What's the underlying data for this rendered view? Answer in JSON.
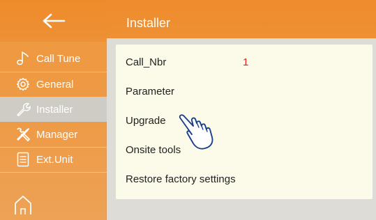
{
  "sidebar": {
    "items": [
      {
        "label": "Call Tune",
        "icon": "music-note-icon"
      },
      {
        "label": "General",
        "icon": "gear-icon"
      },
      {
        "label": "Installer",
        "icon": "wrench-icon"
      },
      {
        "label": "Manager",
        "icon": "tools-icon"
      },
      {
        "label": "Ext.Unit",
        "icon": "ext-unit-icon"
      }
    ],
    "active_index": 2
  },
  "header": {
    "title": "Installer",
    "back_icon": "back-arrow-icon",
    "home_icon": "home-icon"
  },
  "main": {
    "rows": [
      {
        "label": "Call_Nbr",
        "value": "1"
      },
      {
        "label": "Parameter"
      },
      {
        "label": "Upgrade"
      },
      {
        "label": "Onsite tools"
      },
      {
        "label": "Restore factory settings"
      }
    ]
  },
  "colors": {
    "accent": "#ef8c2c",
    "sidebar_active": "#cfccc6",
    "card_bg": "#fcfbe9",
    "value_red": "#e02020"
  }
}
